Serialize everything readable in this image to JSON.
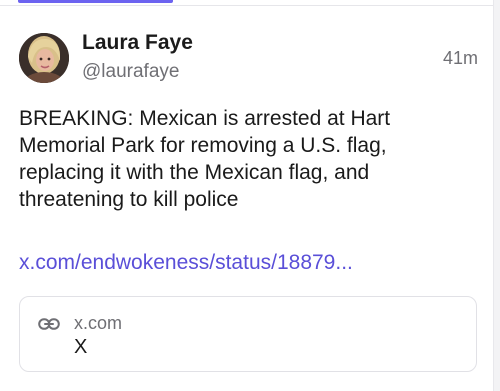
{
  "post": {
    "author": {
      "display_name": "Laura Faye",
      "handle": "@laurafaye",
      "avatar_icon": "profile-photo"
    },
    "timestamp": "41m",
    "text": "BREAKING: Mexican is arrested at Hart\nMemorial Park for removing a U.S. flag,\nreplacing it with the Mexican flag, and\nthreatening to kill police",
    "link_text": "x.com/endwokeness/status/18879...",
    "link_card": {
      "icon": "link-icon",
      "domain": "x.com",
      "title": "X"
    }
  },
  "colors": {
    "accent": "#6c63f0",
    "link": "#5a4fd8",
    "muted_text": "#6f6f74",
    "body_text": "#1a1a1a",
    "border": "#e1e1e6"
  }
}
